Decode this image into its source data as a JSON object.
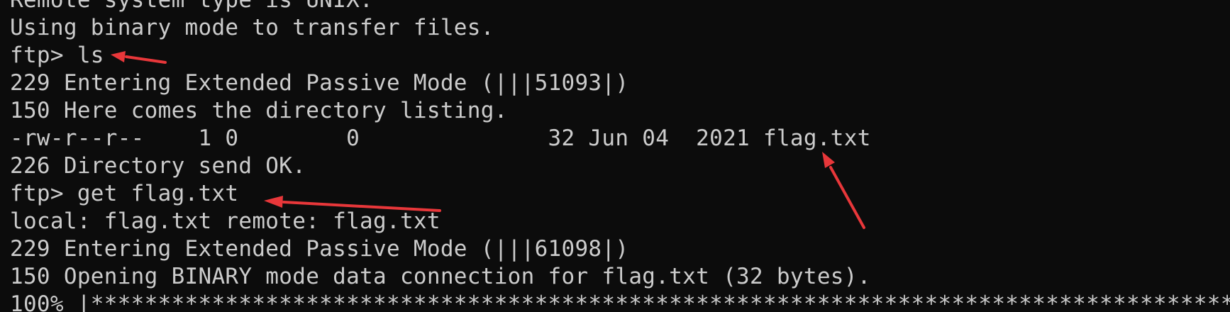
{
  "terminal": {
    "lines": [
      "Remote system type is UNIX.",
      "Using binary mode to transfer files.",
      "ftp> ls",
      "229 Entering Extended Passive Mode (|||51093|)",
      "150 Here comes the directory listing.",
      "-rw-r--r--    1 0        0              32 Jun 04  2021 flag.txt",
      "226 Directory send OK.",
      "ftp> get flag.txt",
      "local: flag.txt remote: flag.txt",
      "229 Entering Extended Passive Mode (|||61098|)",
      "150 Opening BINARY mode data connection for flag.txt (32 bytes).",
      "100% |*******************************************************************************************"
    ]
  },
  "colors": {
    "background": "#0c0c0c",
    "text": "#cccccc",
    "annotation_arrow": "#e8373a"
  }
}
